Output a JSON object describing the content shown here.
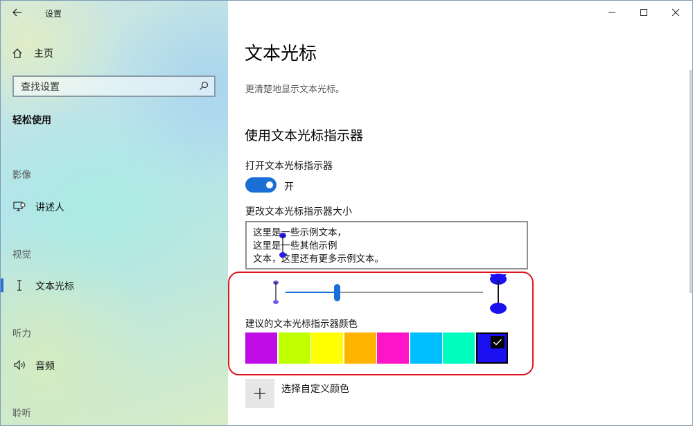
{
  "window": {
    "app_title": "设置",
    "controls": {
      "minimize_icon": "minimize-icon",
      "maximize_icon": "maximize-icon",
      "close_icon": "close-icon"
    }
  },
  "sidebar": {
    "home_label": "主页",
    "search_placeholder": "查找设置",
    "section_heading": "轻松使用",
    "groups": {
      "vision_label": "影像",
      "visual_label": "视觉",
      "hearing_label": "听力",
      "interaction_label": "聆听"
    },
    "items": {
      "narrator": "讲述人",
      "text_cursor": "文本光标",
      "audio": "音频"
    },
    "active_item": "文本光标"
  },
  "main": {
    "title": "文本光标",
    "description": "更清楚地显示文本光标。",
    "section_title": "使用文本光标指示器",
    "toggle_label": "打开文本光标指示器",
    "toggle_state": "开",
    "toggle_on": true,
    "size_label": "更改文本光标指示器大小",
    "preview_lines": [
      "这里是一些示例文本，",
      "这里是一些其他示例",
      "文本，这里还有更多示例文本。"
    ],
    "slider_value_fraction": 0.26,
    "color_label": "建议的文本光标指示器颜色",
    "colors": [
      "#c00de8",
      "#bfff00",
      "#ffff00",
      "#ffb400",
      "#ff14c8",
      "#00bfff",
      "#00ffbf",
      "#1a10f0"
    ],
    "selected_color_index": 7,
    "custom_color_label": "选择自定义颜色",
    "accent_color": "#1a6fd6",
    "highlight_color": "#e0161e"
  }
}
